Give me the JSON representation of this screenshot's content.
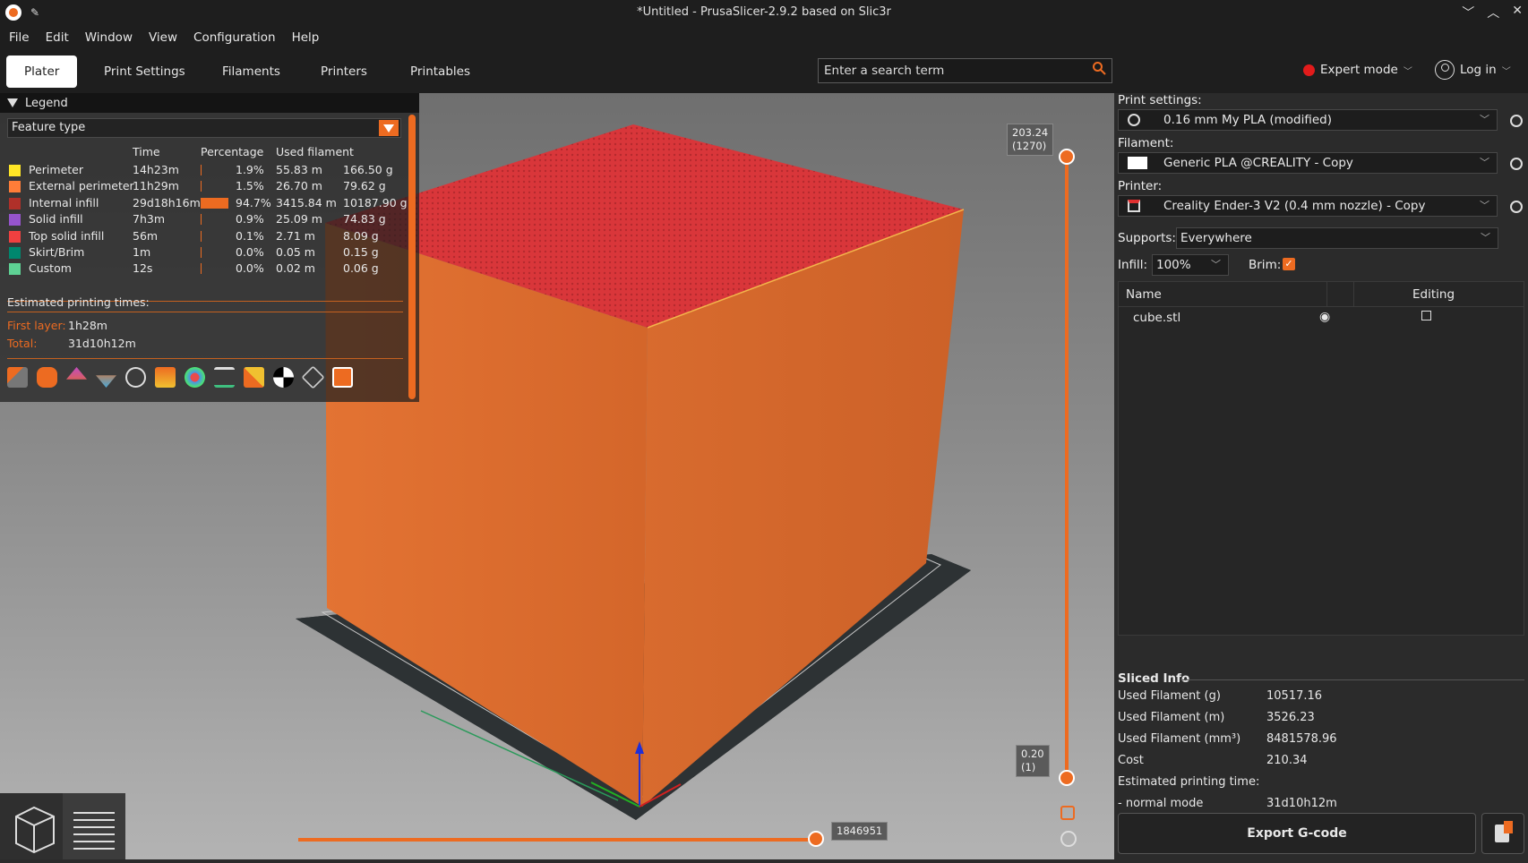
{
  "window": {
    "title": "*Untitled - PrusaSlicer-2.9.2 based on Slic3r"
  },
  "menu": [
    "File",
    "Edit",
    "Window",
    "View",
    "Configuration",
    "Help"
  ],
  "tabs": [
    "Plater",
    "Print Settings",
    "Filaments",
    "Printers",
    "Printables"
  ],
  "search": {
    "placeholder": "Enter a search term"
  },
  "mode": {
    "label": "Expert mode",
    "color": "#e21b1b"
  },
  "account": {
    "label": "Log in"
  },
  "legend": {
    "title": "Legend",
    "view_type": "Feature type",
    "columns": [
      "Time",
      "Percentage",
      "Used filament"
    ],
    "rows": [
      {
        "name": "Perimeter",
        "color": "#ffe626",
        "time": "14h23m",
        "pct": "1.9%",
        "pct_value": 1.9,
        "len": "55.83 m",
        "weight": "166.50 g"
      },
      {
        "name": "External perimeter",
        "color": "#ff7d38",
        "time": "11h29m",
        "pct": "1.5%",
        "pct_value": 1.5,
        "len": "26.70 m",
        "weight": "79.62 g"
      },
      {
        "name": "Internal infill",
        "color": "#b03029",
        "time": "29d18h16m",
        "pct": "94.7%",
        "pct_value": 94.7,
        "len": "3415.84 m",
        "weight": "10187.90 g"
      },
      {
        "name": "Solid infill",
        "color": "#9654cc",
        "time": "7h3m",
        "pct": "0.9%",
        "pct_value": 0.9,
        "len": "25.09 m",
        "weight": "74.83 g"
      },
      {
        "name": "Top solid infill",
        "color": "#f04040",
        "time": "56m",
        "pct": "0.1%",
        "pct_value": 0.1,
        "len": "2.71 m",
        "weight": "8.09 g"
      },
      {
        "name": "Skirt/Brim",
        "color": "#00876e",
        "time": "1m",
        "pct": "0.0%",
        "pct_value": 0.0,
        "len": "0.05 m",
        "weight": "0.15 g"
      },
      {
        "name": "Custom",
        "color": "#5ed194",
        "time": "12s",
        "pct": "0.0%",
        "pct_value": 0.0,
        "len": "0.02 m",
        "weight": "0.06 g"
      }
    ],
    "estimated_title": "Estimated printing times:",
    "first_layer_label": "First layer:",
    "first_layer": "1h28m",
    "total_label": "Total:",
    "total": "31d10h12m"
  },
  "layer_slider": {
    "top_height": "203.24",
    "top_layer": "(1270)",
    "bottom_height": "0.20",
    "bottom_layer": "(1)"
  },
  "move_slider": {
    "value": "1846951"
  },
  "sidebar": {
    "print_settings_label": "Print settings:",
    "print_settings_value": "0.16 mm My PLA (modified)",
    "filament_label": "Filament:",
    "filament_value": "Generic PLA @CREALITY - Copy",
    "printer_label": "Printer:",
    "printer_value": "Creality Ender-3 V2 (0.4 mm nozzle) - Copy",
    "supports_label": "Supports:",
    "supports_value": "Everywhere",
    "infill_label": "Infill:",
    "infill_value": "100%",
    "brim_label": "Brim:",
    "brim_checked": true
  },
  "objects": {
    "columns": [
      "Name",
      "Editing"
    ],
    "items": [
      {
        "name": "cube.stl"
      }
    ]
  },
  "sliced_info": {
    "title": "Sliced Info",
    "rows": [
      {
        "label": "Used Filament (g)",
        "value": "10517.16"
      },
      {
        "label": "Used Filament (m)",
        "value": "3526.23"
      },
      {
        "label": "Used Filament (mm³)",
        "value": "8481578.96"
      },
      {
        "label": "Cost",
        "value": "210.34"
      },
      {
        "label": "Estimated printing time:",
        "value": ""
      },
      {
        "label": " - normal mode",
        "value": "31d10h12m"
      }
    ]
  },
  "export": {
    "label": "Export G-code"
  },
  "accent": "#ed6b21"
}
